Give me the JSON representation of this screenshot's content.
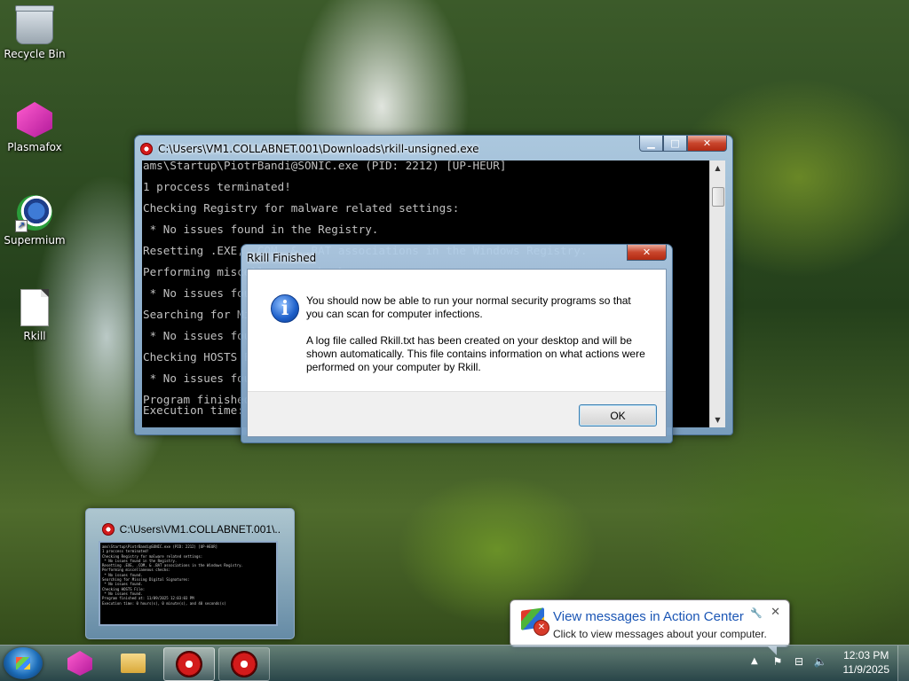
{
  "desktop": {
    "icons": [
      {
        "label": "Recycle Bin",
        "icon": "recycle-bin-icon"
      },
      {
        "label": "Plasmafox",
        "icon": "plasmafox-icon"
      },
      {
        "label": "Supermium",
        "icon": "supermium-icon"
      },
      {
        "label": "Rkill",
        "icon": "text-file-icon"
      }
    ]
  },
  "console_window": {
    "title": "C:\\Users\\VM1.COLLABNET.001\\Downloads\\rkill-unsigned.exe",
    "lines": [
      "ams\\Startup\\PiotrBandi@SONIC.exe (PID: 2212) [UP-HEUR]",
      "",
      "1 proccess terminated!",
      "",
      "Checking Registry for malware related settings:",
      "",
      " * No issues found in the Registry.",
      "",
      "Resetting .EXE, .COM, & .BAT associations in the Windows Registry.",
      "",
      "Performing miscellaneous checks:",
      "",
      " * No issues found.",
      "",
      "Searching for Missing Digital Signatures:",
      "",
      " * No issues found.",
      "",
      "Checking HOSTS File:",
      "",
      " * No issues found.",
      "",
      "Program finished at: 11/09/2025 12:03:03 PM",
      "Execution time: 0 hours(s), 0 minute(s), and 40 seconds(s)"
    ]
  },
  "dialog": {
    "title": "Rkill Finished",
    "paragraph1": "You should now be able to run your normal security programs so that you can scan for computer infections.",
    "paragraph2": "A log file called Rkill.txt has been created on your desktop and will be shown automatically.  This file contains information on what actions were performed on your computer by Rkill.",
    "ok_label": "OK"
  },
  "thumbnail": {
    "title": "C:\\Users\\VM1.COLLABNET.001\\...",
    "mini_lines": [
      "ams\\Startup\\PiotrBandi@SONIC.exe (PID: 2212) [UP-HEUR]",
      "1 proccess terminated!",
      "Checking Registry for malware related settings:",
      " * No issues found in the Registry.",
      "Resetting .EXE, .COM, & .BAT associations in the Windows Registry.",
      "Performing miscellaneous checks:",
      " * No issues found.",
      "Searching for Missing Digital Signatures:",
      " * No issues found.",
      "Checking HOSTS File:",
      " * No issues found.",
      "Program finished at: 11/09/2025 12:03:03 PM",
      "Execution time: 0 hours(s), 0 minute(s), and 40 seconds(s)"
    ]
  },
  "action_center": {
    "title": "View messages in Action Center",
    "subtitle": "Click to view messages about your computer."
  },
  "taskbar": {
    "clock_time": "12:03 PM",
    "clock_date": "11/9/2025",
    "tray_arrow": "▲"
  }
}
